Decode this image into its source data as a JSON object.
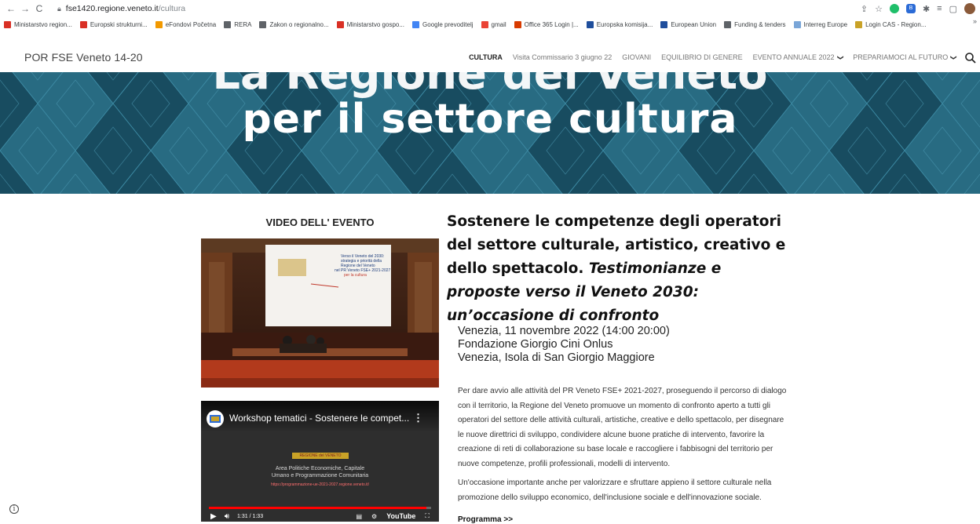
{
  "browser": {
    "url_host": "fse1420.regione.veneto.it",
    "url_path": "/cultura",
    "bookmarks": [
      {
        "label": "Ministarstvo region...",
        "icon": "grid-icon",
        "color": "#d93025"
      },
      {
        "label": "Europski strukturni...",
        "icon": "flag-icon",
        "color": "#d93025"
      },
      {
        "label": "eFondovi Početna",
        "icon": "efondovi-icon",
        "color": "#f29900"
      },
      {
        "label": "RERA",
        "icon": "globe-icon",
        "color": "#5f6368"
      },
      {
        "label": "Zakon o regionalno...",
        "icon": "globe-icon",
        "color": "#5f6368"
      },
      {
        "label": "Ministarstvo gospo...",
        "icon": "grid-icon",
        "color": "#d93025"
      },
      {
        "label": "Google prevoditelj",
        "icon": "translate-icon",
        "color": "#4285f4"
      },
      {
        "label": "gmail",
        "icon": "gmail-icon",
        "color": "#ea4335"
      },
      {
        "label": "Office 365 Login |...",
        "icon": "office-icon",
        "color": "#d83b01"
      },
      {
        "label": "Europska komisija...",
        "icon": "eu-flag-icon",
        "color": "#1f4e9c"
      },
      {
        "label": "European Union",
        "icon": "eu-flag-icon",
        "color": "#1f4e9c"
      },
      {
        "label": "Funding & tenders",
        "icon": "globe-icon",
        "color": "#5f6368"
      },
      {
        "label": "Interreg Europe",
        "icon": "interreg-icon",
        "color": "#7aa6d8"
      },
      {
        "label": "Login CAS - Region...",
        "icon": "cas-icon",
        "color": "#c9a227"
      }
    ],
    "bookmarks_more": "»"
  },
  "site": {
    "title": "POR FSE Veneto 14-20",
    "menu": [
      {
        "label": "CULTURA",
        "active": true,
        "dropdown": false
      },
      {
        "label": "Visita Commissario 3 giugno 22",
        "active": false,
        "dropdown": false
      },
      {
        "label": "GIOVANI",
        "active": false,
        "dropdown": false
      },
      {
        "label": "EQUILIBRIO DI GENERE",
        "active": false,
        "dropdown": false
      },
      {
        "label": "EVENTO ANNUALE 2022",
        "active": false,
        "dropdown": true
      },
      {
        "label": "PREPARIAMOCI AL FUTURO",
        "active": false,
        "dropdown": true
      }
    ]
  },
  "hero": {
    "line1": "La Regione del Veneto",
    "line2": "per il settore cultura",
    "bg_color": "#1e5a71"
  },
  "left": {
    "video_heading": "VIDEO DELL' EVENTO",
    "slide_title": "Verso il Veneto del 2030: strategia e priorità della Regione del Veneto nel PR Veneto FSE+ 2021-2027 per la cultura",
    "youtube": {
      "title": "Workshop tematici - Sostenere le compet...",
      "banner": "REGIONE del VENETO",
      "slide_text_1": "Area Politiche Economiche, Capitale",
      "slide_text_2": "Umano e Programmazione Comunitaria",
      "slide_link": "https://programmazione-ue-2021-2027.regione.veneto.it/",
      "time": "1:31 / 1:33",
      "brand": "YouTube",
      "progress": 0.98
    }
  },
  "article": {
    "title_plain": "Sostenere le competenze degli operatori del settore culturale, artistico, creativo e dello spettacolo.",
    "title_italic": "Testimonianze e proposte verso il Veneto 2030: un’occasione di confronto",
    "date_line": "Venezia, 11 novembre 2022 (14:00 20:00)",
    "venue_line": "Fondazione Giorgio Cini Onlus",
    "place_line": "Venezia, Isola di San Giorgio Maggiore",
    "paragraph_1": "Per dare avvio alle attività del PR Veneto FSE+ 2021-2027, proseguendo il percorso di dialogo con il territorio, la Regione del Veneto promuove un momento di confronto aperto a tutti gli operatori del settore delle attività culturali, artistiche, creative e dello spettacolo, per disegnare le nuove direttrici di sviluppo, condividere alcune buone pratiche di intervento, favorire la creazione di reti di collaborazione su base locale e raccogliere i fabbisogni del territorio per nuove competenze, profili professionali, modelli di intervento.",
    "paragraph_2": "Un'occasione importante anche per valorizzare e sfruttare appieno il settore culturale nella promozione dello sviluppo economico, dell'inclusione sociale e dell'innovazione sociale.",
    "program_link": "Programma >>"
  }
}
